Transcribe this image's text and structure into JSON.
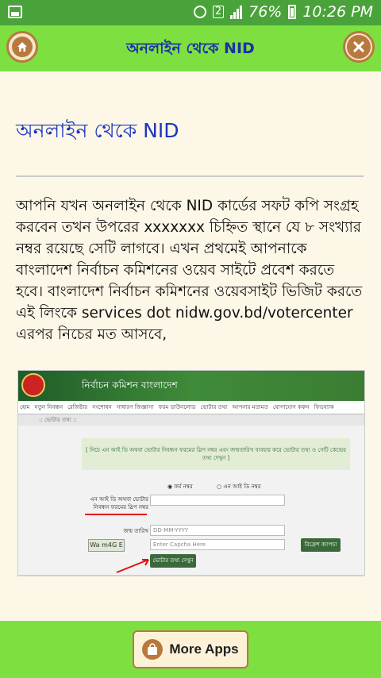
{
  "status_bar": {
    "sim": "2",
    "battery": "76%",
    "time": "10:26 PM"
  },
  "app_bar": {
    "title": "অনলাইন থেকে NID",
    "home_icon": "home-icon",
    "close_icon": "close-icon"
  },
  "article": {
    "heading": "অনলাইন থেকে NID",
    "body": "আপনি যখন অনলাইন থেকে NID কার্ডের সফট কপি সংগ্রহ করবেন তখন উপরের xxxxxxx চিহ্নিত স্থানে যে ৮ সংখ্যার নম্বর রয়েছে সেটি লাগবে। এখন প্রথমেই আপনাকে বাংলাদেশ নির্বাচন কমিশনের ওয়েব সাইটে প্রবেশ করতে হবে। বাংলাদেশ নির্বাচন কমিশনের ওয়েবসাইট ভিজিট করতে এই লিংকে services dot nidw.gov.bd/votercenter এরপর নিচের মত আসবে,"
  },
  "screenshot": {
    "banner": "নির্বাচন কমিশন বাংলাদেশ",
    "nav": [
      "হোম",
      "নতুন নিবন্ধন",
      "রেজিষ্টার",
      "সংশোধন",
      "সাধারণ জিজ্ঞাসা",
      "ফরম ডাউনলোড",
      "ভোটার তথ্য",
      "আপনার মতামত",
      "যোগাযোগ করুন",
      "ফিডব্যাক"
    ],
    "crumb": ":: ভোটার তথ্য ::",
    "notice": "[ নিচে এন আই ডি অথবা ভোটার নিবন্ধন ফরমের স্লিপ নম্বর এবং জন্মতারিখ ব্যবহার করে ভোটার তথ্য ও সেটি কেন্দ্রের তথ্য দেখুন ]",
    "radio_form": "ফর্ম নম্বর",
    "radio_nid": "এন আই ডি নম্বর",
    "nid_label": "এন আই ডি অথবা ভোটার নিবন্ধন ফরমের স্লিপ নম্বর",
    "dob_label": "জন্ম তারিখ",
    "dob_placeholder": "DD-MM-YYYY",
    "captcha_text": "Wa m4G E",
    "captcha_placeholder": "Enter Capcha Here",
    "refresh_button": "রিফ্রেশ ক্যাপচা",
    "submit_button": "ভোটার তথ্য দেখুন"
  },
  "bottom_bar": {
    "more_apps": "More Apps",
    "bag_icon": "shopping-bag-icon"
  }
}
